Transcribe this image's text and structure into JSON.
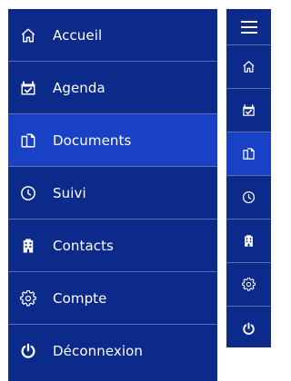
{
  "colors": {
    "menu_bg": "#0b2a8a",
    "active_bg": "#1941c6",
    "divider": "#5a6fb3",
    "text": "#ffffff"
  },
  "menu": {
    "items": [
      {
        "label": "Accueil",
        "icon": "home-icon",
        "active": false
      },
      {
        "label": "Agenda",
        "icon": "calendar-icon",
        "active": false
      },
      {
        "label": "Documents",
        "icon": "documents-icon",
        "active": true
      },
      {
        "label": "Suivi",
        "icon": "clock-icon",
        "active": false
      },
      {
        "label": "Contacts",
        "icon": "building-icon",
        "active": false
      },
      {
        "label": "Compte",
        "icon": "gear-icon",
        "active": false
      },
      {
        "label": "Déconnexion",
        "icon": "power-icon",
        "active": false
      }
    ]
  },
  "rail": {
    "toggle_icon": "hamburger-icon",
    "items": [
      {
        "icon": "home-icon",
        "active": false
      },
      {
        "icon": "calendar-icon",
        "active": false
      },
      {
        "icon": "documents-icon",
        "active": true
      },
      {
        "icon": "clock-icon",
        "active": false
      },
      {
        "icon": "building-icon",
        "active": false
      },
      {
        "icon": "gear-icon",
        "active": false
      },
      {
        "icon": "power-icon",
        "active": false
      }
    ]
  }
}
